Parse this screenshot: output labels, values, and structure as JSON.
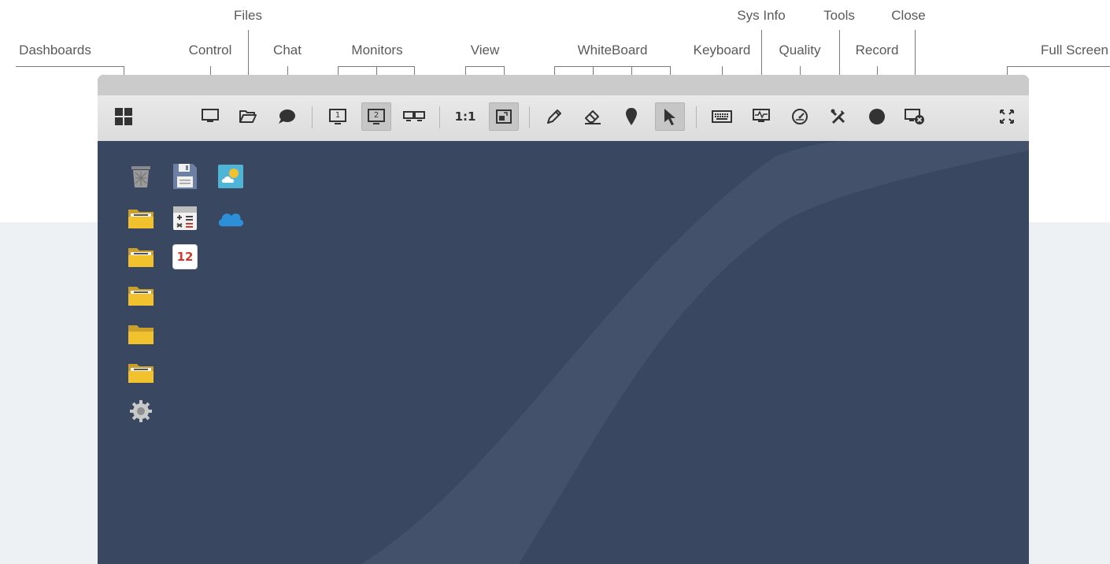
{
  "labels": {
    "dashboards": "Dashboards",
    "control": "Control",
    "files": "Files",
    "chat": "Chat",
    "monitors": "Monitors",
    "view": "View",
    "whiteboard": "WhiteBoard",
    "keyboard": "Keyboard",
    "sys_info": "Sys Info",
    "quality": "Quality",
    "tools": "Tools",
    "record": "Record",
    "close": "Close",
    "full_screen": "Full Screen"
  },
  "toolbar": {
    "monitor_1": "1",
    "monitor_2": "2",
    "view_ratio": "1:1",
    "active_monitor": "2",
    "active_tools": [
      "view-fit",
      "pointer"
    ]
  },
  "desktop": {
    "calendar_day": "12",
    "icons": [
      "recycle-bin-icon",
      "save-disk-icon",
      "weather-icon",
      "folder-icon",
      "calculator-icon",
      "cloud-icon",
      "folder-icon",
      "calendar-icon",
      "folder-icon",
      "folder-icon",
      "folder-icon",
      "settings-gear-icon"
    ]
  },
  "colors": {
    "desktop_bg": "#394860",
    "toolbar_bg": "#e2e2e2",
    "folder": "#f2c12e",
    "cloud": "#2d8fd8",
    "record": "#333333"
  }
}
